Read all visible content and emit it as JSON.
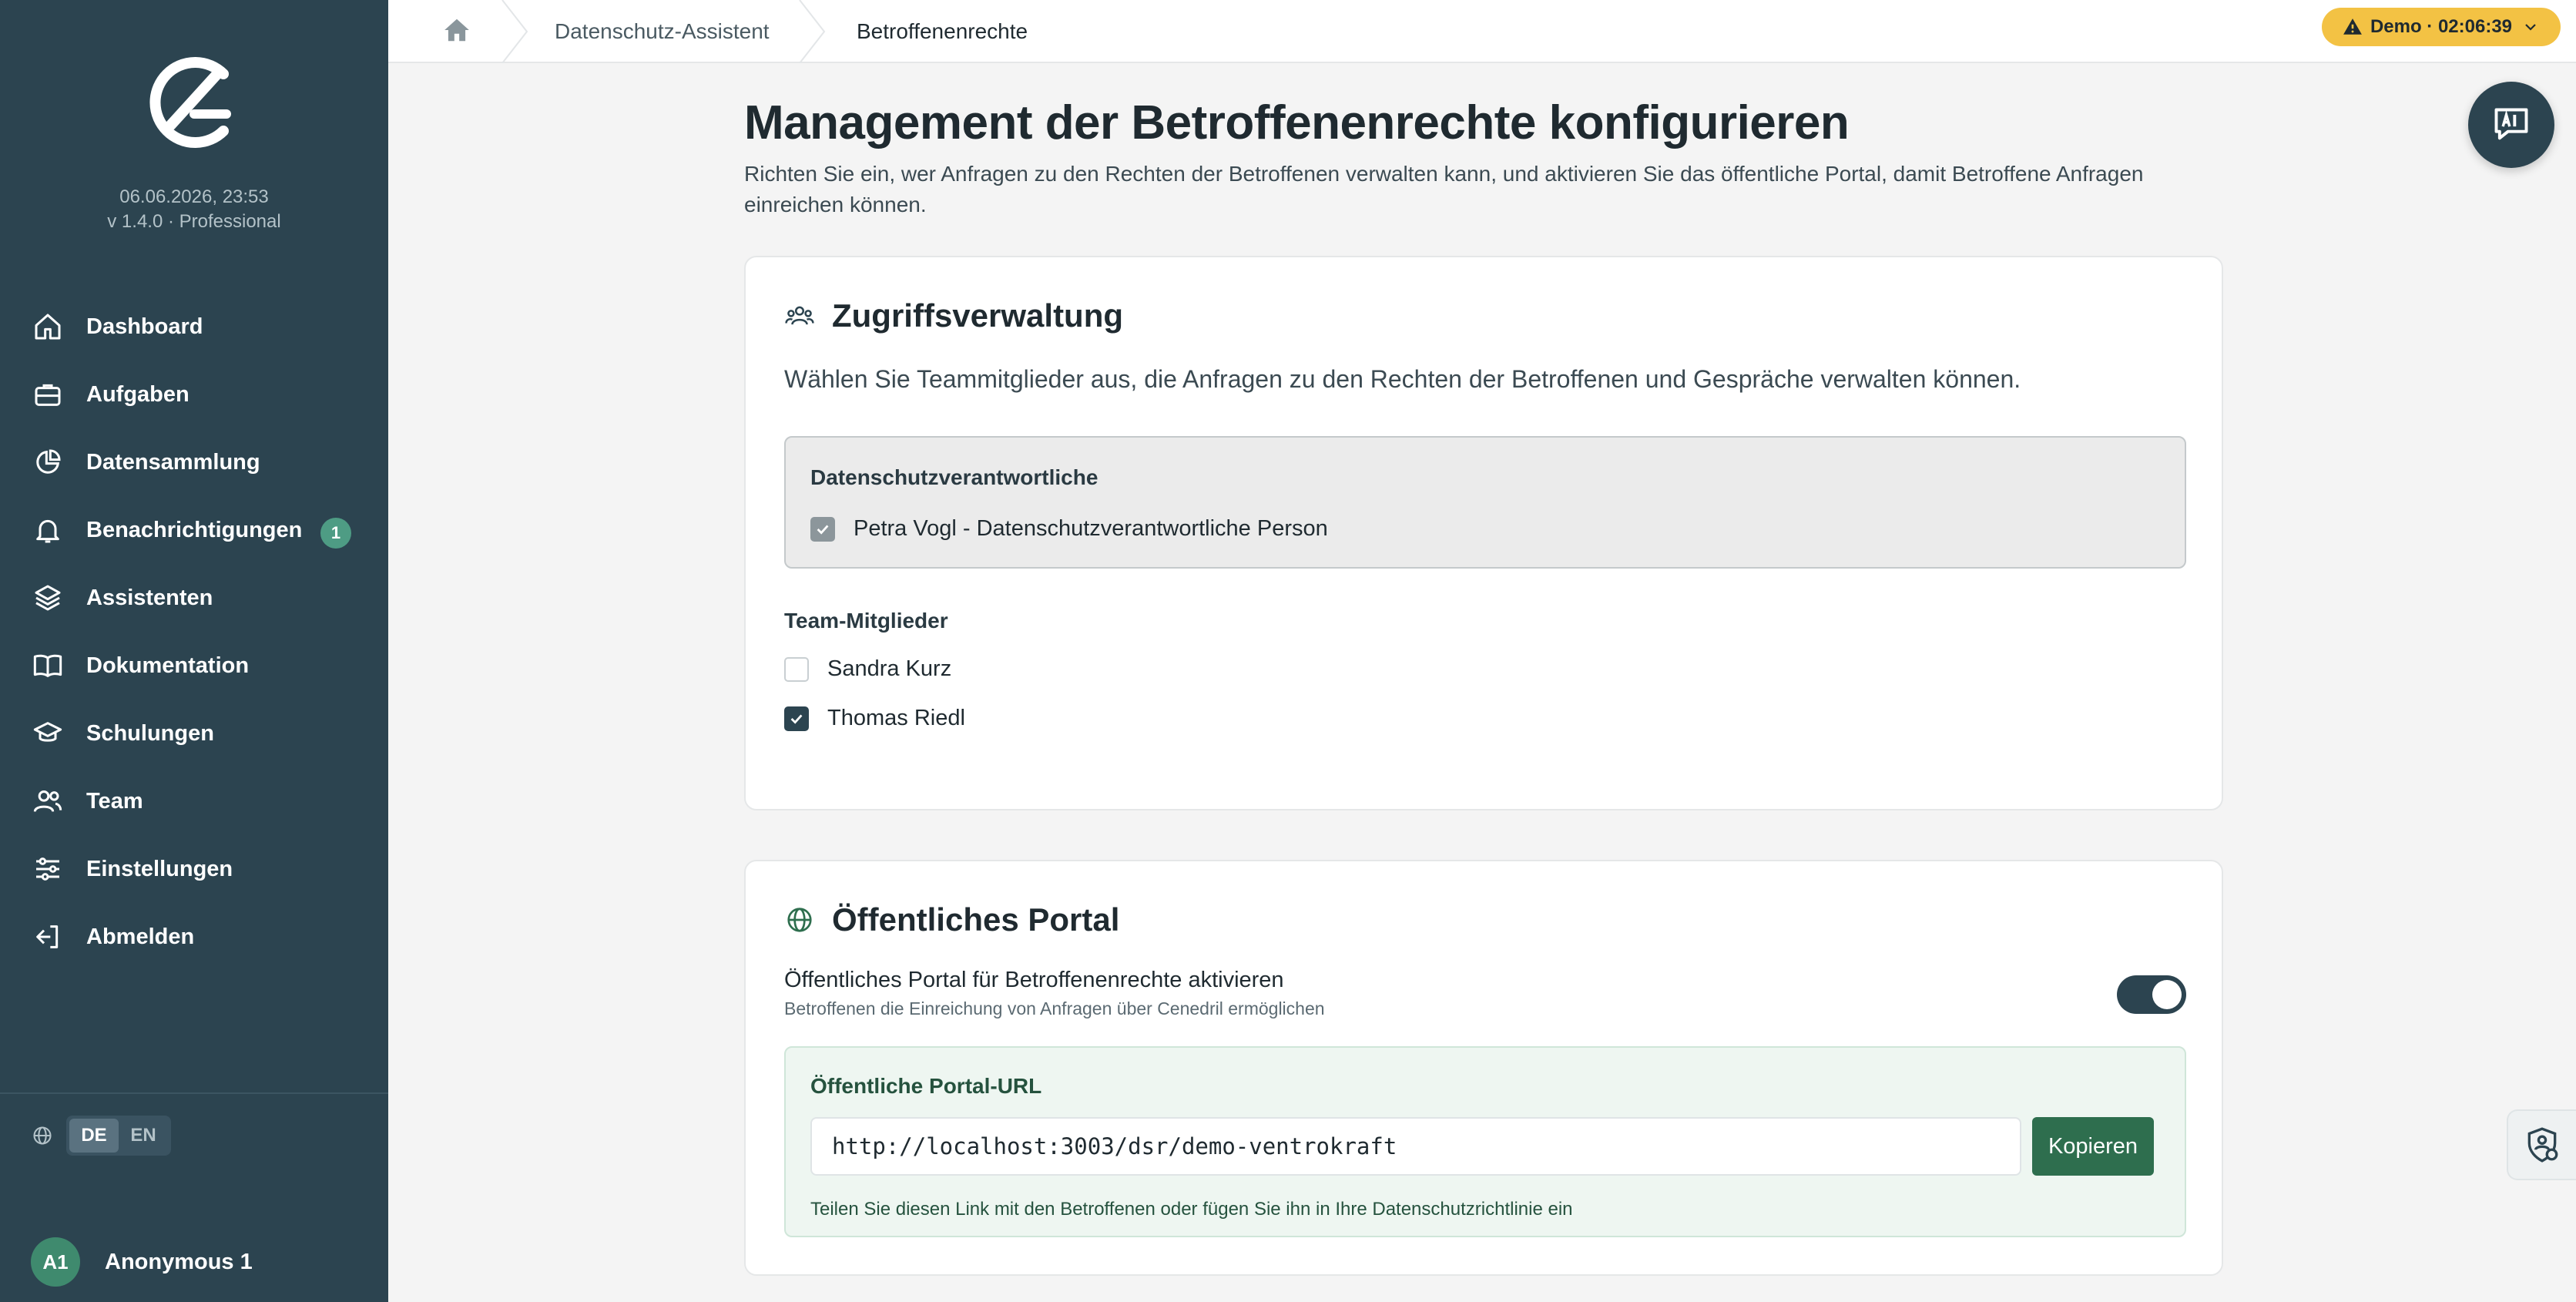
{
  "sidebar": {
    "date": "06.06.2026, 23:53",
    "version": "v 1.4.0 · Professional",
    "items": [
      {
        "label": "Dashboard",
        "icon": "home-icon"
      },
      {
        "label": "Aufgaben",
        "icon": "briefcase-icon"
      },
      {
        "label": "Datensammlung",
        "icon": "pie-chart-icon"
      },
      {
        "label": "Benachrichtigungen",
        "icon": "bell-icon",
        "badge": "1"
      },
      {
        "label": "Assistenten",
        "icon": "layers-icon"
      },
      {
        "label": "Dokumentation",
        "icon": "book-icon"
      },
      {
        "label": "Schulungen",
        "icon": "graduation-cap-icon"
      },
      {
        "label": "Team",
        "icon": "users-icon"
      },
      {
        "label": "Einstellungen",
        "icon": "sliders-icon"
      },
      {
        "label": "Abmelden",
        "icon": "logout-icon"
      }
    ],
    "languages": [
      "DE",
      "EN"
    ],
    "active_language": "DE",
    "user": {
      "initials": "A1",
      "name": "Anonymous 1"
    }
  },
  "topbar": {
    "breadcrumbs": [
      "Datenschutz-Assistent",
      "Betroffenenrechte"
    ],
    "demo_label": "Demo · 02:06:39"
  },
  "main": {
    "title": "Management der Betroffenenrechte konfigurieren",
    "description": "Richten Sie ein, wer Anfragen zu den Rechten der Betroffenen verwalten kann, und aktivieren Sie das öffentliche Portal, damit Betroffene Anfragen einreichen können."
  },
  "access": {
    "title": "Zugriffsverwaltung",
    "subtitle": "Wählen Sie Teammitglieder aus, die Anfragen zu den Rechten der Betroffenen und Gespräche verwalten können.",
    "dpo_label": "Datenschutzverantwortliche",
    "dpo_person": "Petra Vogl - Datenschutzverantwortliche Person",
    "team_label": "Team-Mitglieder",
    "members": [
      {
        "name": "Sandra Kurz",
        "checked": false
      },
      {
        "name": "Thomas Riedl",
        "checked": true
      }
    ]
  },
  "portal": {
    "title": "Öffentliches Portal",
    "toggle_label": "Öffentliches Portal für Betroffenenrechte aktivieren",
    "toggle_desc": "Betroffenen die Einreichung von Anfragen über Cenedril ermöglichen",
    "enabled": true,
    "url_label": "Öffentliche Portal-URL",
    "url": "http://localhost:3003/dsr/demo-ventrokraft",
    "copy_label": "Kopieren",
    "hint": "Teilen Sie diesen Link mit den Betroffenen oder fügen Sie ihn in Ihre Datenschutzrichtlinie ein"
  },
  "colors": {
    "sidebar": "#2c4450",
    "accent_green": "#2e6e4e",
    "badge": "#4e9c84",
    "demo_pill": "#f3c244"
  }
}
